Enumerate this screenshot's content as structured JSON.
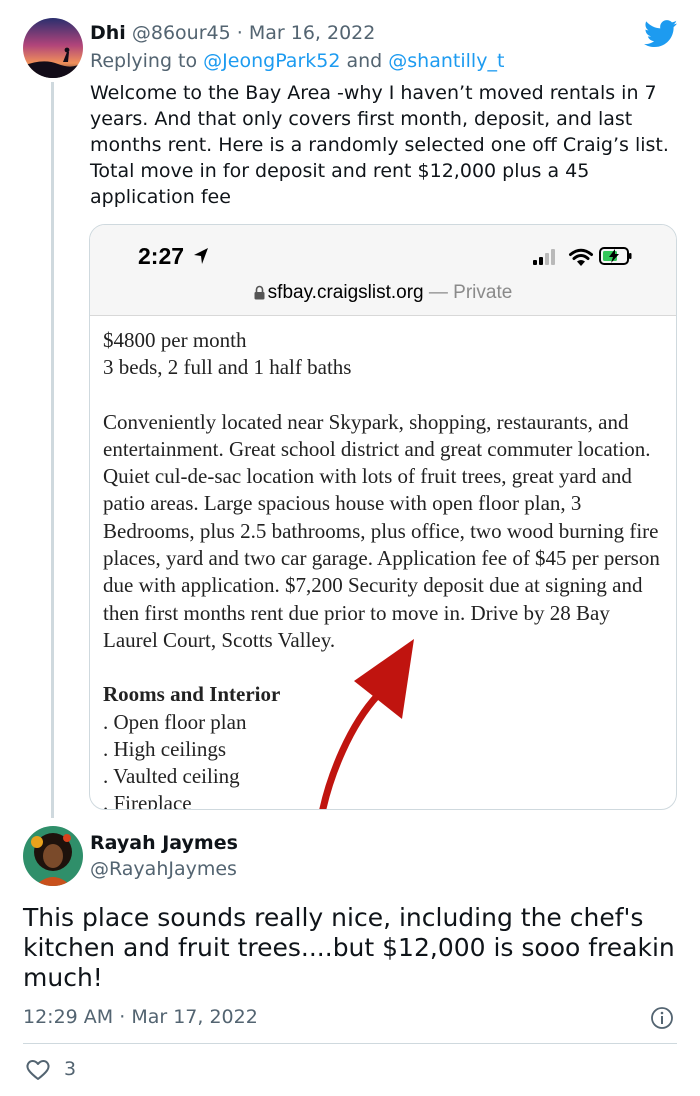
{
  "tweet1": {
    "display_name": "Dhi",
    "handle": "@86our45",
    "separator": "·",
    "date": "Mar 16, 2022",
    "replying_to_prefix": "Replying to",
    "reply_handle_1": "@JeongPark52",
    "reply_and": "and",
    "reply_handle_2": "@shantilly_t",
    "text": "Welcome to the Bay Area -why I haven’t moved rentals in 7 years.  And that only covers first month, deposit, and last months rent.  Here is a randomly selected one off Craig’s list. Total move in for deposit and rent $12,000 plus a 45 application fee"
  },
  "screenshot": {
    "time": "2:27",
    "url": "sfbay.craigslist.org",
    "mode": "— Private",
    "lines": {
      "price": "$4800 per month",
      "rooms": "3 beds, 2 full and 1 half baths",
      "description": "Conveniently located near Skypark, shopping, restaurants, and entertainment. Great school district and great commuter location. Quiet cul-de-sac location with lots of fruit trees, great yard and patio areas. Large spacious house with open floor plan, 3 Bedrooms, plus 2.5 bathrooms, plus office, two wood burning fire places, yard and two car garage. Application fee of $45 per person due with application. $7,200 Security deposit due at signing and then first months rent due prior to move in. Drive by 28 Bay Laurel Court, Scotts Valley.",
      "section_heading": "Rooms and Interior",
      "item_1": ". Open floor plan",
      "item_2": ". High ceilings",
      "item_3": ". Vaulted ceiling",
      "item_4": ". Fireplace"
    }
  },
  "tweet2": {
    "display_name": "Rayah Jaymes",
    "handle": "@RayahJaymes",
    "text": "This place sounds really nice, including the chef's kitchen and fruit trees....but $12,000 is sooo freakin much!",
    "time": "12:29 AM",
    "separator": "·",
    "date": "Mar 17, 2022",
    "like_count": "3"
  },
  "icons": {
    "brand": "twitter-bird-icon",
    "info": "info-icon",
    "like": "heart-icon",
    "location": "location-arrow-icon",
    "signal": "cellular-signal-icon",
    "wifi": "wifi-icon",
    "battery": "battery-charging-icon",
    "lock": "lock-icon"
  },
  "colors": {
    "twitter_blue": "#1d9bf0",
    "text_primary": "#0f1419",
    "text_secondary": "#536471",
    "annotation_arrow": "#c0140f"
  }
}
